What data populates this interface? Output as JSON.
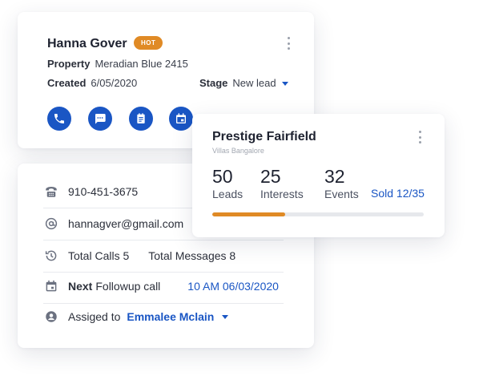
{
  "lead": {
    "name": "Hanna Gover",
    "badge": "HOT",
    "property_label": "Property",
    "property_value": "Meradian Blue 2415",
    "created_label": "Created",
    "created_value": "6/05/2020",
    "stage_label": "Stage",
    "stage_value": "New lead",
    "actions": [
      "phone-icon",
      "chat-icon",
      "notes-icon",
      "calendar-icon"
    ]
  },
  "contact": {
    "phone": "910-451-3675",
    "email": "hannagver@gmail.com",
    "total_calls": "Total Calls 5",
    "total_messages": "Total Messages 8",
    "next_label": "Next",
    "followup_label": "Followup call",
    "followup_time": "10 AM 06/03/2020",
    "assigned_label": "Assiged to",
    "assigned_value": "Emmalee Mclain"
  },
  "project": {
    "title": "Prestige Fairfield",
    "subtitle": "Villas Bangalore",
    "stats": [
      {
        "value": "50",
        "label": "Leads"
      },
      {
        "value": "25",
        "label": "Interests"
      },
      {
        "value": "32",
        "label": "Events"
      }
    ],
    "sold_text": "Sold 12/35",
    "sold_count": 12,
    "sold_total": 35
  },
  "colors": {
    "primary": "#1a56c4",
    "accent": "#e08a25",
    "track": "#e6e8ec"
  }
}
